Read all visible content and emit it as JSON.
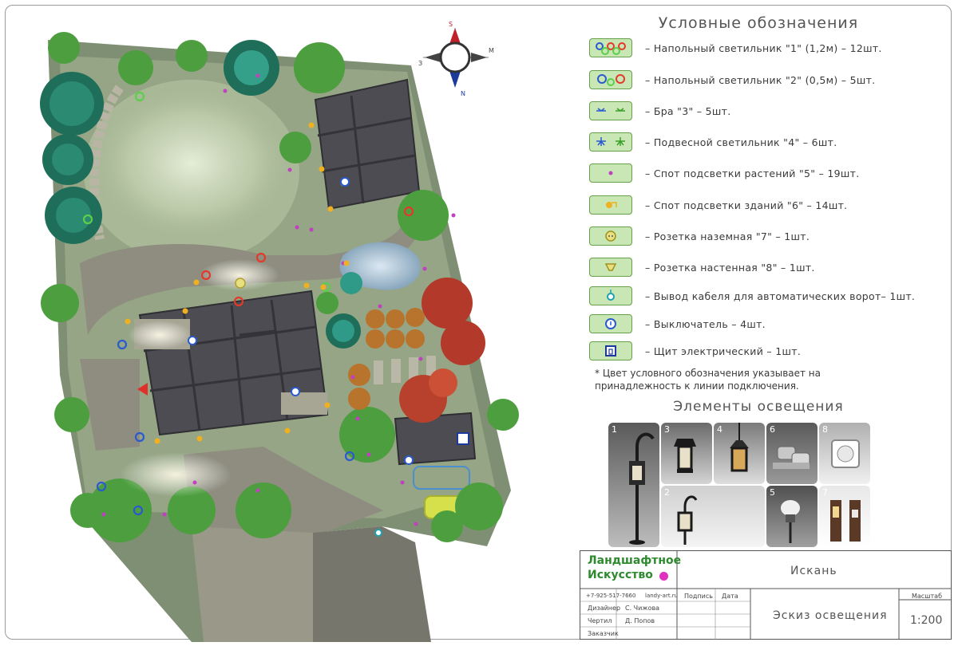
{
  "compass": {
    "south": "S",
    "north": "N",
    "west": "З",
    "east": "М"
  },
  "legend": {
    "title": "Условные обозначения",
    "items": [
      {
        "icon": "floor-lamp-1-icon",
        "text": "– Напольный светильник \"1\" (1,2м) – 12шт."
      },
      {
        "icon": "floor-lamp-2-icon",
        "text": "– Напольный светильник \"2\" (0,5м) – 5шт."
      },
      {
        "icon": "sconce-3-icon",
        "text": "– Бра \"3\" – 5шт."
      },
      {
        "icon": "pendant-4-icon",
        "text": "– Подвесной светильник \"4\" – 6шт."
      },
      {
        "icon": "plant-spot-5-icon",
        "text": "– Спот подсветки растений \"5\" – 19шт."
      },
      {
        "icon": "building-spot-6-icon",
        "text": "– Спот подсветки зданий \"6\" – 14шт."
      },
      {
        "icon": "ground-socket-7-icon",
        "text": "– Розетка наземная \"7\" – 1шт."
      },
      {
        "icon": "wall-socket-8-icon",
        "text": "– Розетка настенная \"8\" – 1шт."
      },
      {
        "icon": "gate-cable-icon",
        "text": "– Вывод кабеля для автоматических ворот– 1шт."
      },
      {
        "icon": "switch-icon",
        "text": "– Выключатель – 4шт."
      },
      {
        "icon": "electric-panel-icon",
        "text": "– Щит электрический – 1шт."
      }
    ],
    "note_line1": "* Цвет условного обозначения указывает на",
    "note_line2": "принадлежность к линии подключения."
  },
  "elements": {
    "title": "Элементы освещения",
    "tiles": [
      "1",
      "3",
      "4",
      "6",
      "8",
      "2",
      "5",
      "7"
    ]
  },
  "stamp": {
    "logo_line1": "Ландшафтное",
    "logo_line2": "Искусство",
    "project": "Искань",
    "phone": "+7-925-517-7660",
    "site": "landy-art.ru",
    "sign_label": "Подпись",
    "date_label": "Дата",
    "scale_label": "Масштаб",
    "scale_value": "1:200",
    "sheet_title": "Эскиз освещения",
    "roles": [
      {
        "role": "Дизайнер",
        "name": "С. Чижова"
      },
      {
        "role": "Чертил",
        "name": "Д. Попов"
      },
      {
        "role": "Заказчик",
        "name": ""
      }
    ]
  },
  "colors": {
    "lawn": "#9fb08a",
    "plot": "#7d8e72",
    "path": "#8c8a7a",
    "roof": "#4a4a4f",
    "water": "#9db6c8",
    "legend_bg": "#c9e7b4",
    "frame": "#9a9a9a"
  }
}
